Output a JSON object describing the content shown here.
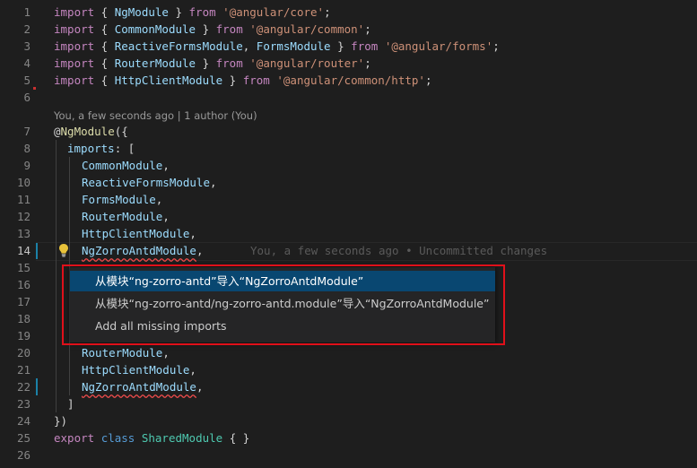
{
  "codelens": "You, a few seconds ago | 1 author (You)",
  "ghost_text": "You, a few seconds ago • Uncommitted changes",
  "line_numbers": [
    "1",
    "2",
    "3",
    "4",
    "5",
    "6",
    "7",
    "8",
    "9",
    "10",
    "11",
    "12",
    "13",
    "14",
    "15",
    "16",
    "17",
    "18",
    "19",
    "20",
    "21",
    "22",
    "23",
    "24",
    "25",
    "26"
  ],
  "lines": {
    "l1": [
      "import",
      " { ",
      "NgModule",
      " } ",
      "from",
      " ",
      "'@angular/core'",
      ";"
    ],
    "l2": [
      "import",
      " { ",
      "CommonModule",
      " } ",
      "from",
      " ",
      "'@angular/common'",
      ";"
    ],
    "l3": [
      "import",
      " { ",
      "ReactiveFormsModule",
      ", ",
      "FormsModule",
      " } ",
      "from",
      " ",
      "'@angular/forms'",
      ";"
    ],
    "l4": [
      "import",
      " { ",
      "RouterModule",
      " } ",
      "from",
      " ",
      "'@angular/router'",
      ";"
    ],
    "l5": [
      "import",
      " { ",
      "HttpClientModule",
      " } ",
      "from",
      " ",
      "'@angular/common/http'",
      ";"
    ],
    "l7": [
      "@",
      "NgModule",
      "({"
    ],
    "l8": [
      "imports",
      ": ["
    ],
    "l9": [
      "CommonModule",
      ","
    ],
    "l10": [
      "ReactiveFormsModule",
      ","
    ],
    "l11": [
      "FormsModule",
      ","
    ],
    "l12": [
      "RouterModule",
      ","
    ],
    "l13": [
      "HttpClientModule",
      ","
    ],
    "l14": [
      "NgZorroAntdModule",
      ","
    ],
    "l20": [
      "RouterModule",
      ","
    ],
    "l21": [
      "HttpClientModule",
      ","
    ],
    "l22": [
      "NgZorroAntdModule",
      ","
    ],
    "l23": [
      "]"
    ],
    "l24": [
      "})"
    ],
    "l25": [
      "export",
      " ",
      "class",
      " ",
      "SharedModule",
      " { }"
    ]
  },
  "quickfix": {
    "items": [
      "从模块“ng-zorro-antd”导入“NgZorroAntdModule”",
      "从模块“ng-zorro-antd/ng-zorro-antd.module”导入“NgZorroAntdModule”",
      "Add all missing imports"
    ],
    "selected_index": 0
  },
  "colors": {
    "background": "#1e1e1e",
    "keyword": "#c586c0",
    "string": "#ce9178",
    "identifier": "#9cdcfe",
    "class": "#4ec9b0",
    "highlight": "#e0101a",
    "selection": "#094771"
  },
  "icons": {
    "lightbulb": "lightbulb-icon"
  }
}
